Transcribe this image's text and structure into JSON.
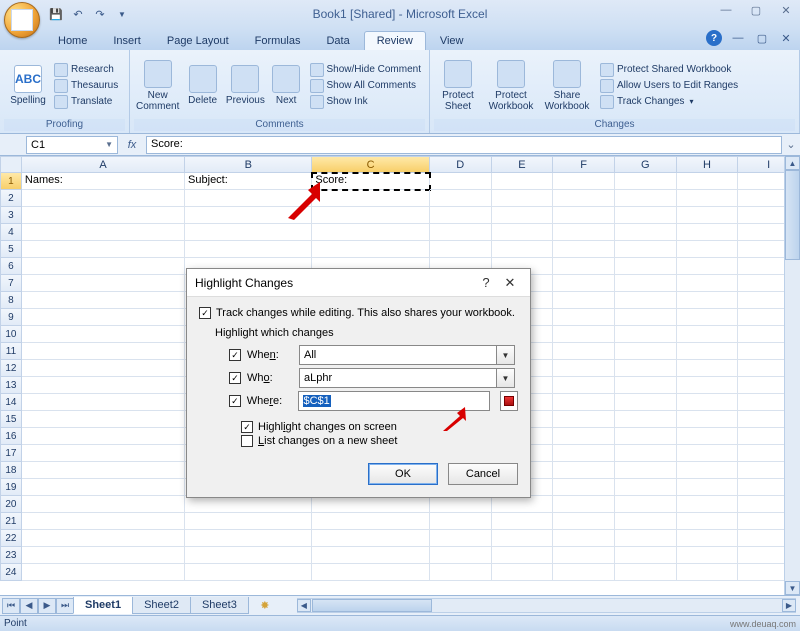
{
  "title": "Book1  [Shared] - Microsoft Excel",
  "tabs": [
    "Home",
    "Insert",
    "Page Layout",
    "Formulas",
    "Data",
    "Review",
    "View"
  ],
  "active_tab": "Review",
  "ribbon": {
    "proofing": {
      "label": "Proofing",
      "spelling": "Spelling",
      "research": "Research",
      "thesaurus": "Thesaurus",
      "translate": "Translate"
    },
    "comments": {
      "label": "Comments",
      "new_comment": "New\nComment",
      "delete": "Delete",
      "previous": "Previous",
      "next": "Next",
      "show_hide": "Show/Hide Comment",
      "show_all": "Show All Comments",
      "show_ink": "Show Ink"
    },
    "changes": {
      "label": "Changes",
      "protect_sheet": "Protect\nSheet",
      "protect_workbook": "Protect\nWorkbook",
      "share_workbook": "Share\nWorkbook",
      "protect_share": "Protect Shared Workbook",
      "allow_users": "Allow Users to Edit Ranges",
      "track_changes": "Track Changes"
    }
  },
  "namebox": "C1",
  "formula": "Score:",
  "columns": [
    "A",
    "B",
    "C",
    "D",
    "E",
    "F",
    "G",
    "H",
    "I"
  ],
  "cells": {
    "A1": "Names:",
    "B1": "Subject:",
    "C1": "Score:"
  },
  "row_count": 24,
  "dialog": {
    "title": "Highlight Changes",
    "track_label": "Track changes while editing. This also shares your workbook.",
    "section": "Highlight which changes",
    "when_label": "When:",
    "when_value": "All",
    "who_label": "Who:",
    "who_value": "aLphr",
    "where_label": "Where:",
    "where_value": "$C$1",
    "highlight_screen": "Highlight changes on screen",
    "list_sheet": "List changes on a new sheet",
    "ok": "OK",
    "cancel": "Cancel"
  },
  "sheets": [
    "Sheet1",
    "Sheet2",
    "Sheet3"
  ],
  "active_sheet": "Sheet1",
  "status": "Point",
  "watermark": "www.deuaq.com"
}
